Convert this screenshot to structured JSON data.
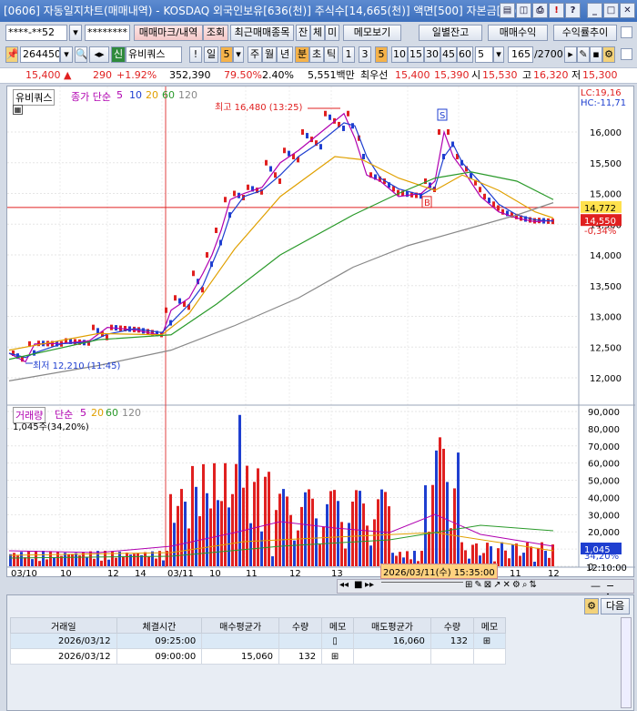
{
  "window": {
    "title": "[0606] 자동일지차트(매매내역) - KOSDAQ 외국인보유[636(천)] 주식수[14,665(천)] 액면[500] 자본금[76(억"
  },
  "toolbar1": {
    "account": "****-**52",
    "password": "********",
    "trade_mark_btn": "매매마크/내역",
    "query_btn": "조회",
    "recent_btn": "최근매매종목",
    "jan": "잔",
    "che": "체",
    "mi": "미",
    "memo_btn": "메모보기",
    "daily_btn": "일별잔고",
    "trade_profit_btn": "매매수익",
    "return_btn": "수익률추이"
  },
  "toolbar2": {
    "code": "264450",
    "sin": "신",
    "name": "유비쿼스",
    "bang": "!",
    "il": "일",
    "num5": "5",
    "ju": "주",
    "wol": "월",
    "nyeon": "년",
    "bun": "분",
    "cho": "초",
    "tik": "틱",
    "periods": [
      "1",
      "3",
      "5",
      "10",
      "15",
      "30",
      "45",
      "60"
    ],
    "period_sel": "5",
    "count": "165",
    "total": "/2700"
  },
  "quote": {
    "price": "15,400 ▲",
    "change": "290",
    "pct": "+1.92%",
    "volume": "352,390",
    "ratio": "79.50%",
    "ratio2": "2.40%",
    "amount": "5,551백만",
    "best_label": "최우선",
    "ask": "15,400",
    "bid": "15,390",
    "open_label": "시",
    "open": "15,530",
    "high_label": "고",
    "high": "16,320",
    "low_label": "저",
    "low": "15,300"
  },
  "chart": {
    "price_legend": {
      "name": "유비쿼스",
      "ma_label": "종가 단순",
      "ma": [
        "5",
        "10",
        "20",
        "60",
        "120"
      ]
    },
    "vol_legend": {
      "name": "거래량",
      "ma_label": "단순",
      "ma": [
        "5",
        "20",
        "60",
        "120"
      ],
      "current": "1,045주(34,20%)"
    },
    "hi_annot": "최고 16,480 (13:25)",
    "lo_annot": "최저 12,210 (11:45)",
    "lc": "LC:19,16",
    "hc": "HC:-11,71",
    "price_ticks": [
      "16,000",
      "15,500",
      "15,000",
      "14,500",
      "14,000",
      "13,500",
      "13,000",
      "12,500",
      "12,000"
    ],
    "vol_ticks": [
      "90,000",
      "80,000",
      "70,000",
      "60,000",
      "50,000",
      "40,000",
      "30,000",
      "20,000",
      "10,000",
      "0"
    ],
    "tag_price1": "14,772",
    "tag_price2": "14,550",
    "tag_pct": "-0,34%",
    "tag_vol": "1,045",
    "tag_vol_pct": "34,20%",
    "x_labels": [
      "03/10",
      "10",
      "12",
      "14",
      "03/11",
      "10",
      "11",
      "12",
      "13",
      "11",
      "12"
    ],
    "crosshair_time": "2026/03/11(수) 15:35:00",
    "time_right": "12:10:00",
    "marks": [
      "S",
      "B"
    ]
  },
  "panel": {
    "next_btn": "다음",
    "headers": [
      "거래일",
      "체결시간",
      "매수평균가",
      "수량",
      "메모",
      "매도평균가",
      "수량",
      "메모"
    ],
    "rows": [
      [
        "2026/03/12",
        "09:25:00",
        "",
        "",
        "",
        "16,060",
        "132",
        ""
      ],
      [
        "2026/03/12",
        "09:00:00",
        "15,060",
        "132",
        "",
        "",
        "",
        ""
      ]
    ]
  }
}
